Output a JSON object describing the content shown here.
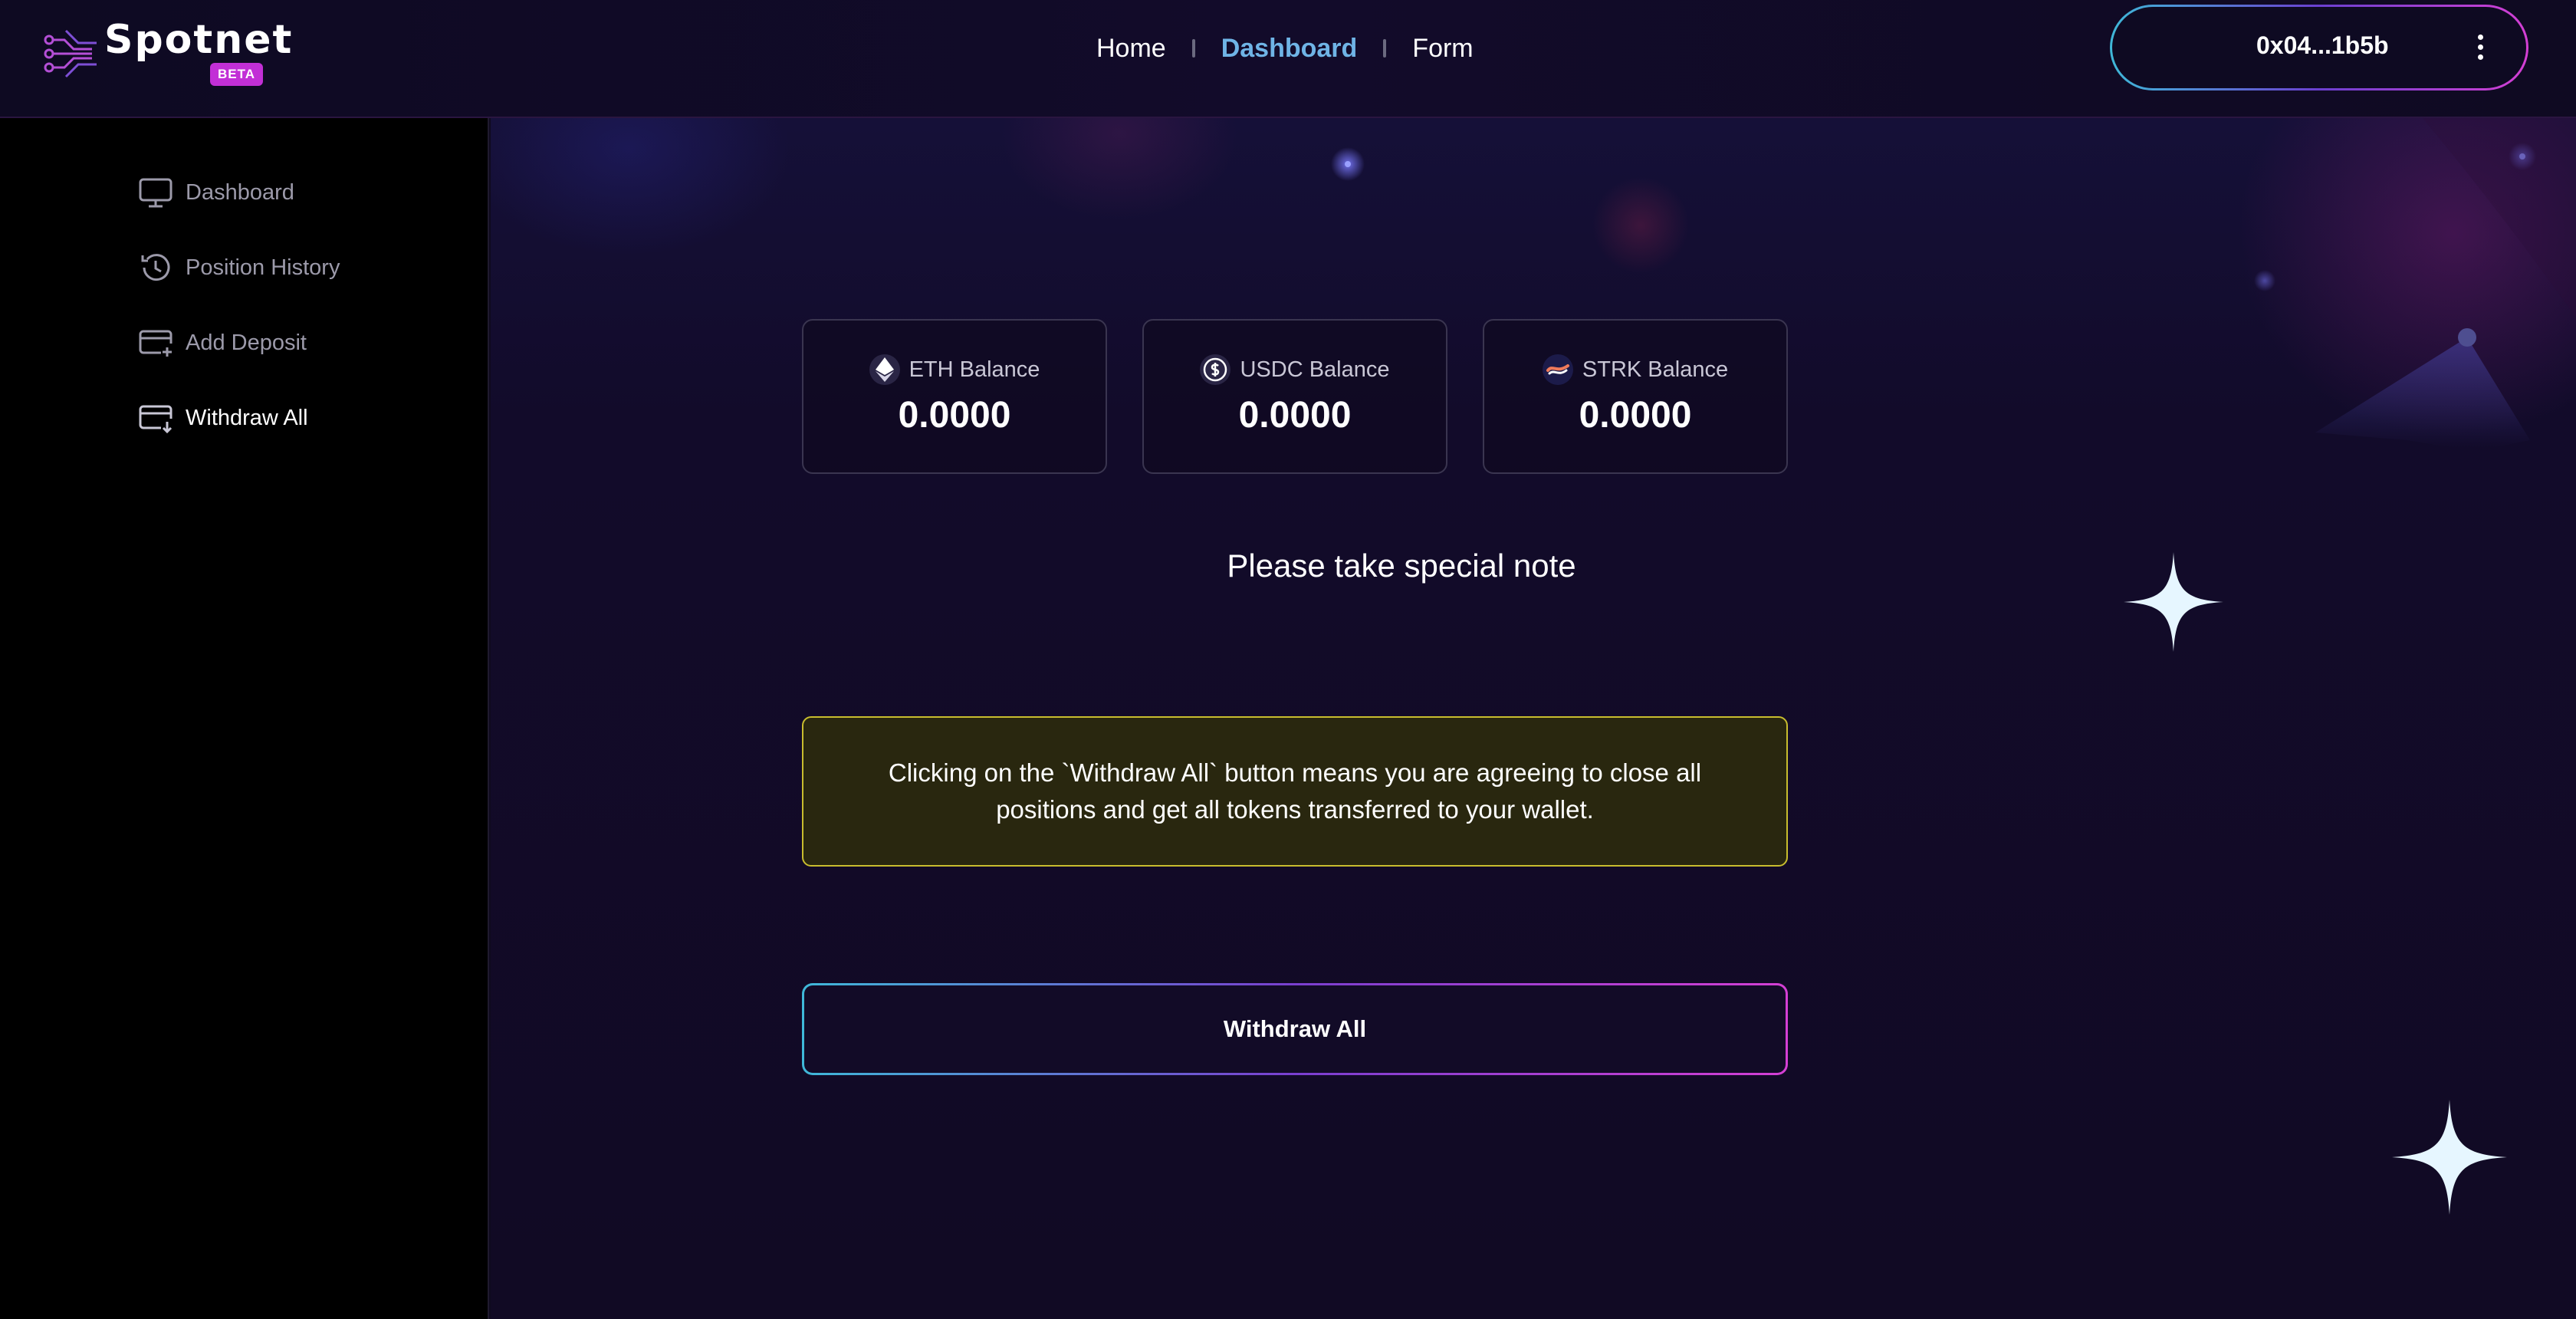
{
  "header": {
    "logo_text": "Spotnet",
    "beta_badge": "BETA",
    "nav": [
      {
        "label": "Home",
        "active": false
      },
      {
        "label": "Dashboard",
        "active": true
      },
      {
        "label": "Form",
        "active": false
      }
    ],
    "wallet_address": "0x04...1b5b"
  },
  "sidebar": {
    "items": [
      {
        "label": "Dashboard",
        "icon": "monitor-icon",
        "active": false
      },
      {
        "label": "Position History",
        "icon": "history-icon",
        "active": false
      },
      {
        "label": "Add Deposit",
        "icon": "card-plus-icon",
        "active": false
      },
      {
        "label": "Withdraw All",
        "icon": "card-withdraw-icon",
        "active": true
      }
    ]
  },
  "balances": [
    {
      "label": "ETH Balance",
      "value": "0.0000",
      "icon": "eth-icon"
    },
    {
      "label": "USDC Balance",
      "value": "0.0000",
      "icon": "usdc-icon"
    },
    {
      "label": "STRK Balance",
      "value": "0.0000",
      "icon": "strk-icon"
    }
  ],
  "note": {
    "title": "Please take special note",
    "warning": "Clicking on the `Withdraw All` button means you are agreeing to close all positions and get all tokens transferred to your wallet."
  },
  "actions": {
    "withdraw_label": "Withdraw All"
  },
  "colors": {
    "accent_nav_active": "#6fb4e6",
    "beta_badge": "#c22fd6",
    "warning_border": "#c8bd2e",
    "warning_bg": "#29270f",
    "gradient_start": "#3fb8d8",
    "gradient_end": "#d43fd4"
  }
}
